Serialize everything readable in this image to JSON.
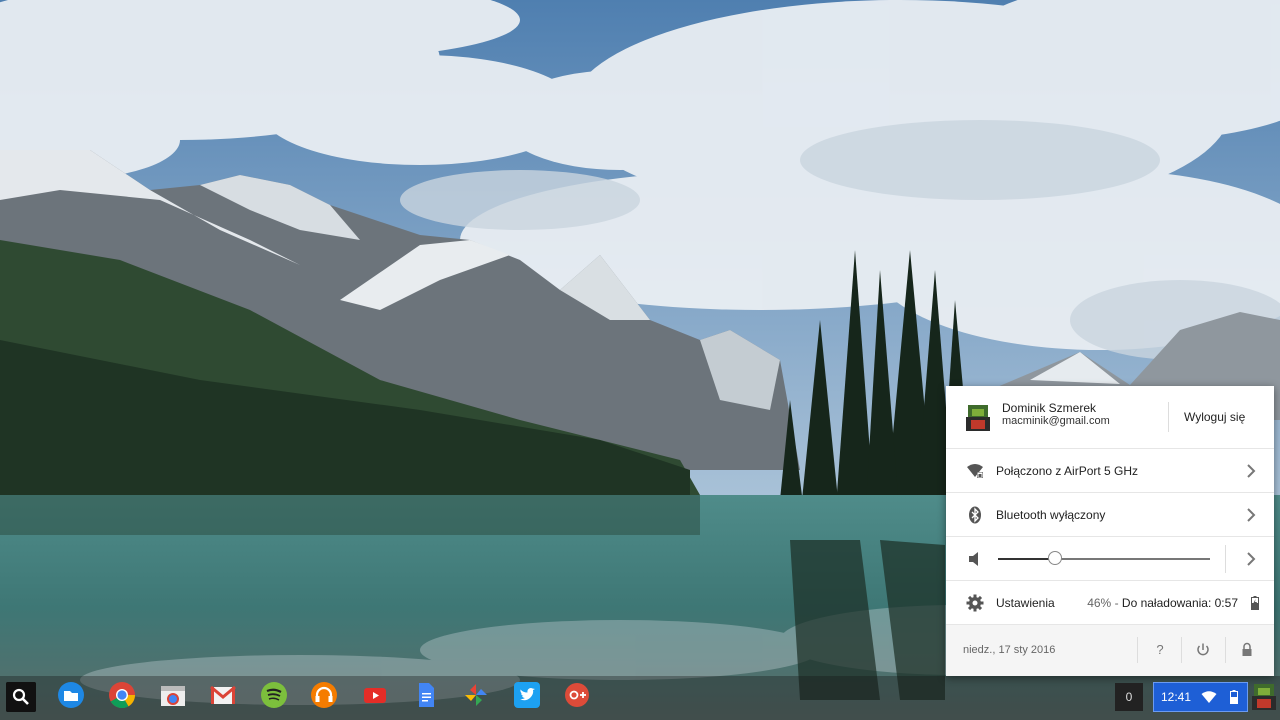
{
  "colors": {
    "accent": "#1e5fd6",
    "tray_bg": "#ffffff",
    "footer_bg": "#f5f5f5"
  },
  "user": {
    "name": "Dominik Szmerek",
    "email": "macminik@gmail.com",
    "sign_out_label": "Wyloguj się"
  },
  "network": {
    "label": "Połączono z AirPort 5 GHz",
    "icon": "wifi-locked-icon"
  },
  "bluetooth": {
    "label": "Bluetooth wyłączony",
    "icon": "bluetooth-icon"
  },
  "volume": {
    "level": 0.27,
    "icon": "speaker-icon"
  },
  "settings": {
    "label": "Ustawienia",
    "battery_percent": "46%",
    "battery_separator": " - ",
    "battery_remaining": "Do naładowania: 0:57"
  },
  "footer": {
    "date": "niedz., 17 sty 2016",
    "help_glyph": "?"
  },
  "shelf": {
    "apps": [
      "files",
      "chrome",
      "web-store",
      "gmail",
      "spotify",
      "google-play-music",
      "youtube",
      "google-docs",
      "google-photos",
      "twitter",
      "google-plus"
    ],
    "notification_count": "0",
    "time": "12:41"
  }
}
